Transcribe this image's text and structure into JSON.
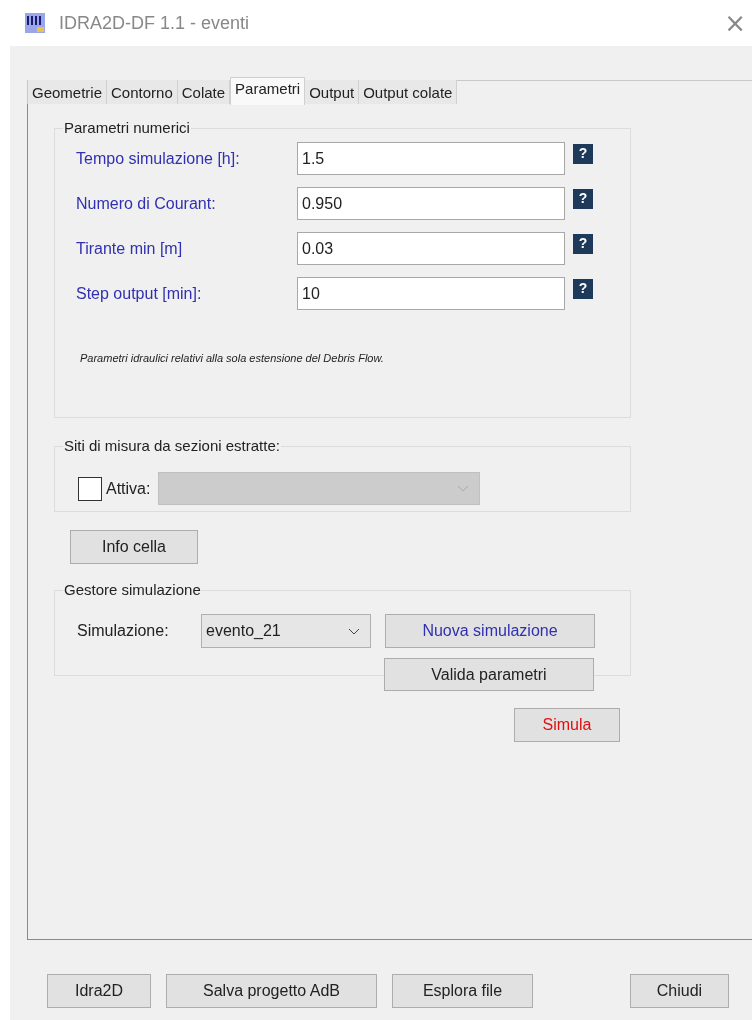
{
  "window": {
    "title": "IDRA2D-DF 1.1 - eventi",
    "close": "×"
  },
  "tabs": [
    {
      "label": "Geometrie",
      "selected": false
    },
    {
      "label": "Contorno",
      "selected": false
    },
    {
      "label": "Colate",
      "selected": false
    },
    {
      "label": "Parametri",
      "selected": true
    },
    {
      "label": "Output",
      "selected": false
    },
    {
      "label": "Output colate",
      "selected": false
    }
  ],
  "numeric_params": {
    "title": "Parametri numerici",
    "fields": [
      {
        "label": "Tempo simulazione [h]:",
        "value": "1.5",
        "help": "?"
      },
      {
        "label": "Numero di Courant:",
        "value": "0.950",
        "help": "?"
      },
      {
        "label": "Tirante min [m]",
        "value": "0.03",
        "help": "?"
      },
      {
        "label": "Step output [min]:",
        "value": "10",
        "help": "?"
      }
    ],
    "note": "Parametri idraulici relativi alla sola estensione del Debris Flow."
  },
  "measure_sites": {
    "title": "Siti di misura da sezioni estratte:",
    "checkbox": {
      "label": "Attiva:",
      "checked": false
    },
    "combo": {
      "disabled": true
    }
  },
  "info_button": "Info cella",
  "simulation_manager": {
    "title": "Gestore simulazione",
    "label": "Simulazione:",
    "combo_value": "evento_21",
    "new_button": "Nuova simulazione",
    "validate_button": "Valida parametri"
  },
  "run_button": "Simula",
  "footer_buttons": [
    "Idra2D",
    "Salva progetto AdB",
    "Esplora file",
    "Chiudi"
  ]
}
